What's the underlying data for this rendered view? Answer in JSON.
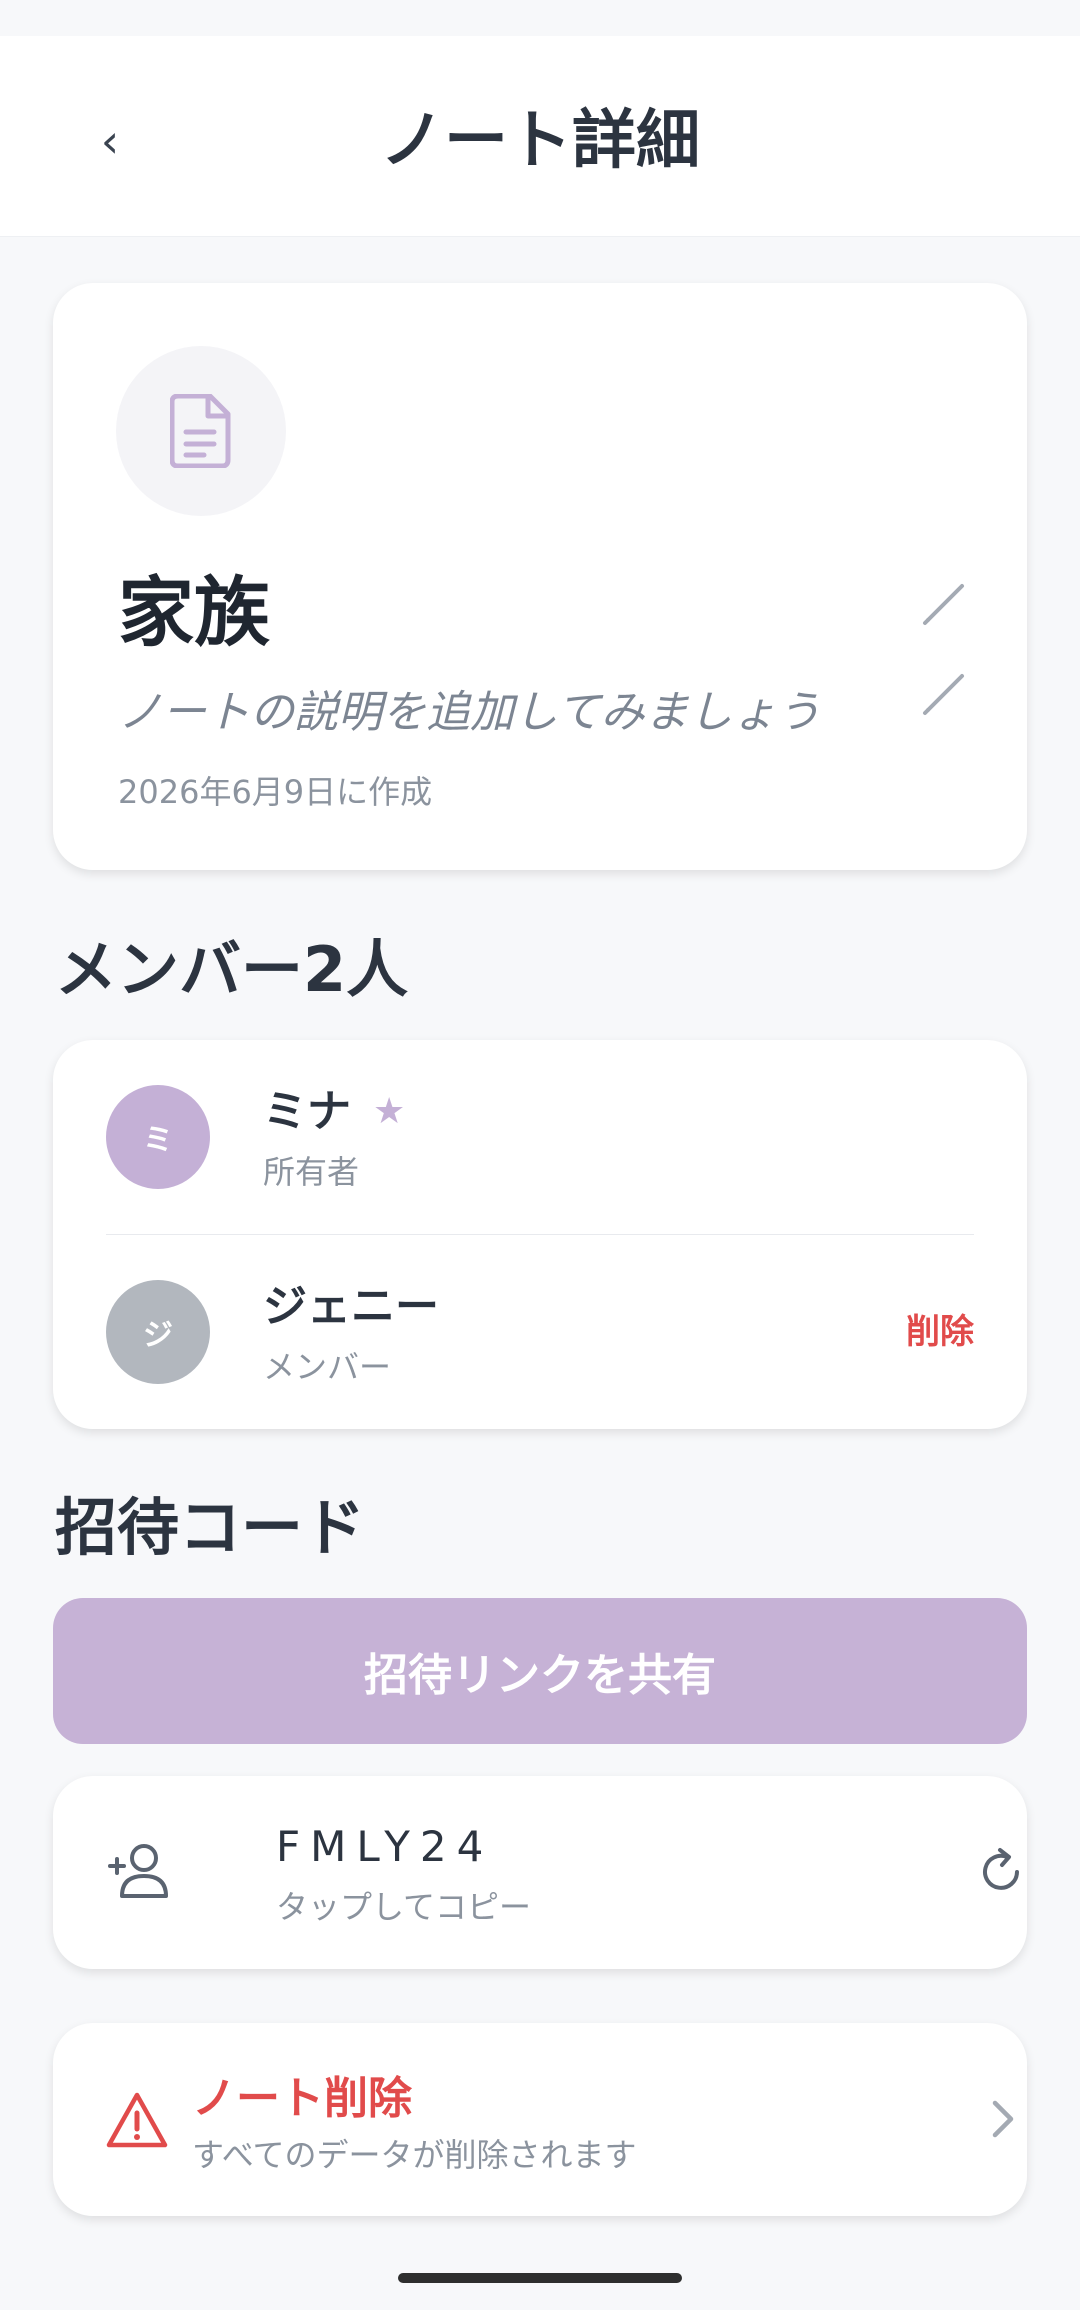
{
  "header": {
    "title": "ノート詳細",
    "back_label": "‹"
  },
  "note": {
    "icon": "document-icon",
    "title": "家族",
    "description_placeholder": "ノートの説明を追加してみましょう",
    "created": "2026年6月9日に作成"
  },
  "members": {
    "section_title": "メンバー2人",
    "items": [
      {
        "initial": "ミ",
        "name": "ミナ",
        "role": "所有者",
        "owner_mark": "★",
        "avatar_color": "#C4B0D6"
      },
      {
        "initial": "ジ",
        "name": "ジェニー",
        "role": "メンバー",
        "remove_label": "削除",
        "avatar_color": "#B2B7BE"
      }
    ]
  },
  "invite": {
    "section_title": "招待コード",
    "share_label": "招待リンクを共有",
    "code": "FMLY24",
    "copy_hint": "タップしてコピー"
  },
  "danger": {
    "title": "ノート削除",
    "description": "すべてのデータが削除されます"
  },
  "colors": {
    "accent": "#C6B2D6",
    "danger": "#E14B4B",
    "background": "#F7F8FA"
  }
}
